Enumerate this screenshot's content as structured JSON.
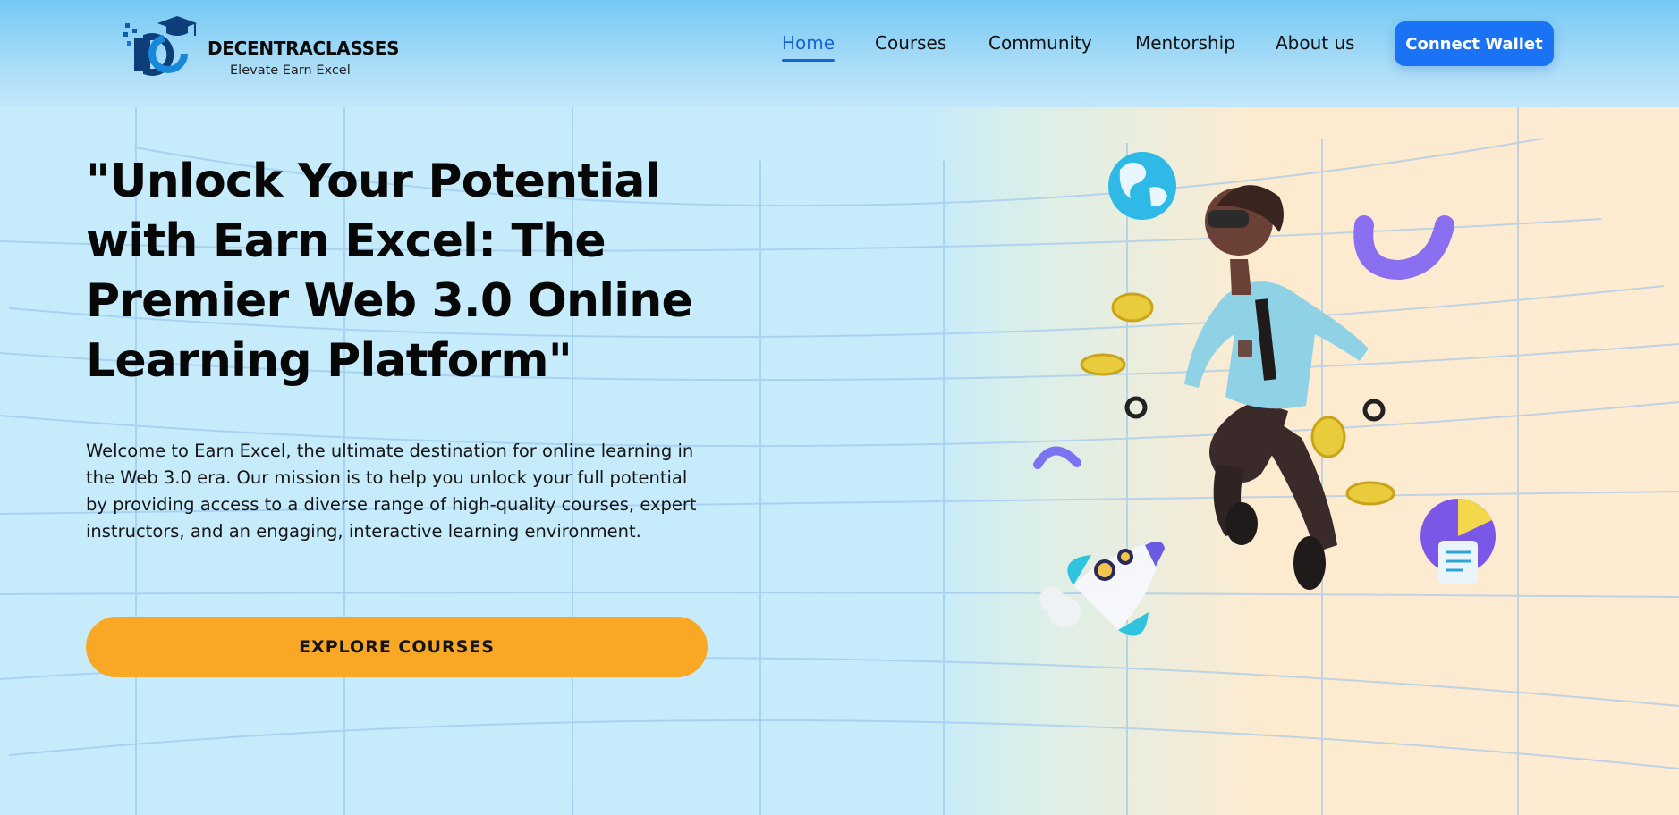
{
  "brand": {
    "name": "DECENTRACLASSES",
    "tagline": "Elevate Earn Excel",
    "logo_icon": "graduation-cap-logo-icon"
  },
  "nav": {
    "items": [
      {
        "label": "Home",
        "active": true
      },
      {
        "label": "Courses",
        "active": false
      },
      {
        "label": "Community",
        "active": false
      },
      {
        "label": "Mentorship",
        "active": false
      },
      {
        "label": "About us",
        "active": false
      }
    ],
    "connect_label": "Connect Wallet"
  },
  "hero": {
    "title": "\"Unlock Your Potential with Earn Excel: The Premier Web 3.0 Online Learning Platform\"",
    "description": "Welcome to Earn Excel, the ultimate destination for online learning in the Web 3.0 era. Our mission is to help you unlock your full potential by providing access to a diverse range of high-quality courses, expert instructors, and an engaging, interactive learning environment.",
    "cta_label": "EXPLORE COURSES"
  },
  "colors": {
    "accent_blue": "#1a73f5",
    "nav_active": "#1565d8",
    "cta_orange": "#f8a825",
    "bg_blue": "#c6ebfb",
    "bg_peach": "#fdebd2"
  },
  "illustration": {
    "icons": [
      "globe-icon",
      "coin-icon",
      "rocket-icon",
      "pie-chart-icon",
      "vr-person-figure",
      "arc-shape-icon"
    ]
  }
}
